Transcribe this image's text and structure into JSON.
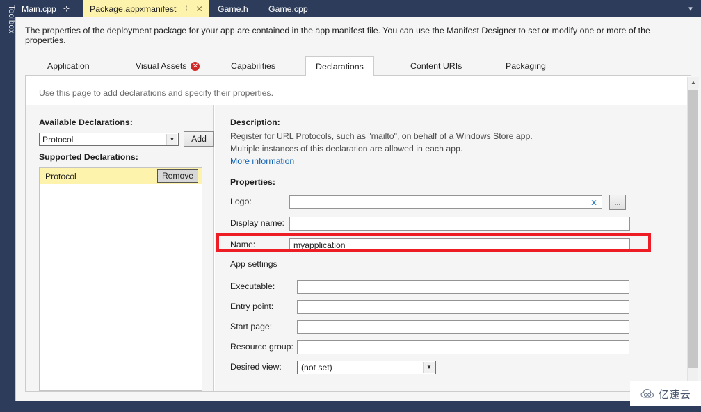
{
  "shell": {
    "toolbox_label": "Toolbox",
    "overflow_icon": "▾",
    "accent_navy": "#2d3c5a",
    "active_tab_yellow": "#fdf3ac",
    "highlight_red": "#ee1c25",
    "link_blue": "#1464b4"
  },
  "document_tabs": [
    {
      "label": "Main.cpp",
      "pin": "⊹",
      "close": "",
      "active": false
    },
    {
      "label": "Package.appxmanifest",
      "pin": "⊹",
      "close": "✕",
      "active": true
    },
    {
      "label": "Game.h",
      "pin": "",
      "close": "",
      "active": false
    },
    {
      "label": "Game.cpp",
      "pin": "",
      "close": "",
      "active": false
    }
  ],
  "designer": {
    "intro": "The properties of the deployment package for your app are contained in the app manifest file. You can use the Manifest Designer to set or modify one or more of the properties.",
    "page_hint": "Use this page to add declarations and specify their properties.",
    "tabs": [
      {
        "label": "Application",
        "error": false,
        "active": false
      },
      {
        "label": "Visual Assets",
        "error": true,
        "error_glyph": "✕",
        "active": false
      },
      {
        "label": "Capabilities",
        "error": false,
        "active": false
      },
      {
        "label": "Declarations",
        "error": false,
        "active": true
      },
      {
        "label": "Content URIs",
        "error": false,
        "active": false
      },
      {
        "label": "Packaging",
        "error": false,
        "active": false
      }
    ]
  },
  "left_panel": {
    "available_label": "Available Declarations:",
    "available_value": "Protocol",
    "available_arrow": "▼",
    "add_label": "Add",
    "supported_label": "Supported Declarations:",
    "supported_items": [
      {
        "label": "Protocol",
        "remove_label": "Remove",
        "selected": true
      }
    ]
  },
  "right_panel": {
    "description_label": "Description:",
    "description_line_1": "Register for URL Protocols, such as \"mailto\", on behalf of a Windows Store app.",
    "description_line_2": "Multiple instances of this declaration are allowed in each app.",
    "more_information": "More information",
    "properties_label": "Properties:",
    "fields": {
      "logo": {
        "label": "Logo:",
        "value": "",
        "placeholder": "",
        "clear_glyph": "✕",
        "browse_label": "..."
      },
      "display_name": {
        "label": "Display name:",
        "value": "",
        "placeholder": ""
      },
      "name": {
        "label": "Name:",
        "value": "myapplication",
        "placeholder": ""
      }
    },
    "app_settings": {
      "legend": "App settings",
      "executable": {
        "label": "Executable:",
        "value": ""
      },
      "entry_point": {
        "label": "Entry point:",
        "value": ""
      },
      "start_page": {
        "label": "Start page:",
        "value": ""
      },
      "resource_group": {
        "label": "Resource group:",
        "value": ""
      },
      "desired_view": {
        "label": "Desired view:",
        "value": "(not set)",
        "arrow": "▼"
      }
    }
  },
  "scrollbar": {
    "up_arrow": "▲",
    "down_arrow": "▼"
  },
  "watermark": {
    "text": "亿速云"
  }
}
